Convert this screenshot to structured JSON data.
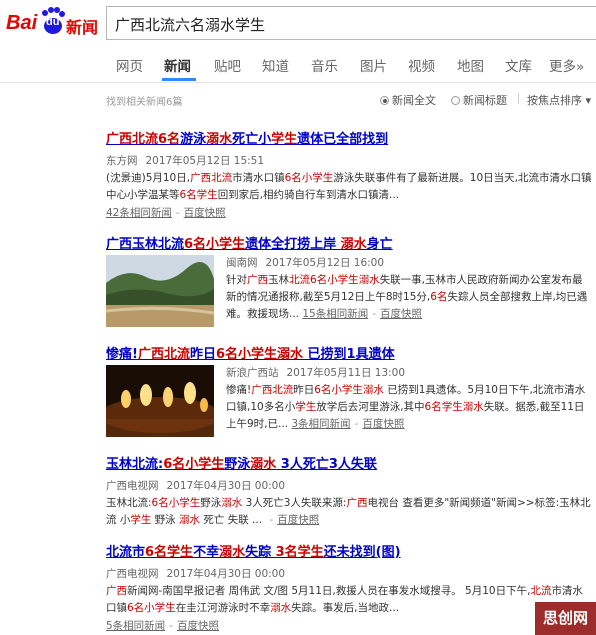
{
  "header": {
    "logo_bai": "Bai",
    "logo_du": "du",
    "logo_news": "新闻",
    "query": "广西北流六名溺水学生"
  },
  "tabs": [
    "网页",
    "新闻",
    "贴吧",
    "知道",
    "音乐",
    "图片",
    "视频",
    "地图",
    "文库",
    "更多»"
  ],
  "active_tab": "新闻",
  "toolbar": {
    "result_count": "找到相关新闻6篇",
    "option_fulltext": "新闻全文",
    "option_title": "新闻标题",
    "sort": "按焦点排序 ▾"
  },
  "results": [
    {
      "title_parts": [
        [
          "广西北流",
          true
        ],
        [
          "6名",
          true
        ],
        [
          "游泳",
          false
        ],
        [
          "溺水",
          true
        ],
        [
          "死亡小",
          false
        ],
        [
          "学生",
          true
        ],
        [
          "遗体已全部找到",
          false
        ]
      ],
      "source": "东方网",
      "time": "2017年05月12日 15:51",
      "summary_parts": [
        [
          "(沈景迪)5月10日,",
          false
        ],
        [
          "广西北流",
          true
        ],
        [
          "市清水口镇",
          false
        ],
        [
          "6名小学生",
          true
        ],
        [
          "游泳失联事件有了最新进展。10日当天,北流市清水口镇中心小学温某等",
          false
        ],
        [
          "6名学生",
          true
        ],
        [
          "回到家后,相约骑自行车到清水口镇清...",
          false
        ]
      ],
      "links": [
        "42条相同新闻",
        "百度快照"
      ]
    },
    {
      "title_parts": [
        [
          "广西玉林北流",
          false
        ],
        [
          "6名小学生",
          true
        ],
        [
          "遗体全打捞上岸 ",
          false
        ],
        [
          "溺水",
          true
        ],
        [
          "身亡",
          false
        ]
      ],
      "source": "闽南网",
      "time": "2017年05月12日 16:00",
      "summary_parts": [
        [
          "针对",
          false
        ],
        [
          "广西",
          true
        ],
        [
          "玉林",
          false
        ],
        [
          "北流",
          true
        ],
        [
          "6名小学生",
          true
        ],
        [
          "溺水",
          true
        ],
        [
          "失联一事,玉林市人民政府新闻办公室发布最新的情况通报称,截至5月12日上午8时15分,",
          false
        ],
        [
          "6名",
          true
        ],
        [
          "失踪人员全部搜救上岸,均已遇难。救援现场...",
          false
        ]
      ],
      "links": [
        "15条相同新闻",
        "百度快照"
      ],
      "image": "river-landscape"
    },
    {
      "title_parts": [
        [
          "惨痛!",
          false
        ],
        [
          "广西北流",
          true
        ],
        [
          "昨日",
          false
        ],
        [
          "6名小学生",
          true
        ],
        [
          "溺水",
          true
        ],
        [
          " 已捞到1具遗体",
          false
        ]
      ],
      "source": "新浪广西站",
      "time": "2017年05月11日 13:00",
      "summary_parts": [
        [
          "惨痛!",
          false
        ],
        [
          "广西北流",
          true
        ],
        [
          "昨日",
          false
        ],
        [
          "6名小学生",
          true
        ],
        [
          "溺水",
          true
        ],
        [
          " 已捞到1具遗体。5月10日下午,北流市清水口镇,10多名小",
          false
        ],
        [
          "学生",
          true
        ],
        [
          "放学后去河里游泳,其中",
          false
        ],
        [
          "6名学生",
          true
        ],
        [
          "溺水",
          true
        ],
        [
          "失联。据悉,截至11日上午9时,已...",
          false
        ]
      ],
      "links": [
        "3条相同新闻",
        "百度快照"
      ],
      "image": "candles"
    },
    {
      "title_parts": [
        [
          "玉林北流:",
          false
        ],
        [
          "6名小学生",
          true
        ],
        [
          "野泳",
          false
        ],
        [
          "溺水",
          true
        ],
        [
          " 3人死亡3人失联",
          false
        ]
      ],
      "source": "广西电视网",
      "time": "2017年04月30日 00:00",
      "summary_parts": [
        [
          "玉林北流:",
          false
        ],
        [
          "6名小学生",
          true
        ],
        [
          "野泳",
          false
        ],
        [
          "溺水",
          true
        ],
        [
          " 3人死亡3人失联来源:",
          false
        ],
        [
          "广西",
          true
        ],
        [
          "电视台 查看更多\"新闻频道\"新闻>>标签:玉林北流 小",
          false
        ],
        [
          "学生",
          true
        ],
        [
          " 野泳 ",
          false
        ],
        [
          "溺水",
          true
        ],
        [
          " 死亡 失联 ...",
          false
        ]
      ],
      "links": [
        "百度快照"
      ]
    },
    {
      "title_parts": [
        [
          "北流市",
          false
        ],
        [
          "6名学生",
          true
        ],
        [
          "不幸",
          false
        ],
        [
          "溺水",
          true
        ],
        [
          "失踪 ",
          false
        ],
        [
          "3名学生",
          true
        ],
        [
          "还未找到(图)",
          false
        ]
      ],
      "source": "广西电视网",
      "time": "2017年04月30日 00:00",
      "summary_parts": [
        [
          "广西",
          true
        ],
        [
          "新闻网-南国早报记者 周伟武 文/图 5月11日,救援人员在事发水域搜寻。 5月10日下午,",
          false
        ],
        [
          "北流",
          true
        ],
        [
          "市清水口镇",
          false
        ],
        [
          "6名小学生",
          true
        ],
        [
          "在圭江河游泳时不幸",
          false
        ],
        [
          "溺水",
          true
        ],
        [
          "失踪。事发后,当地政...",
          false
        ]
      ],
      "links": [
        "5条相同新闻",
        "百度快照"
      ]
    }
  ],
  "watermark": "思创网"
}
